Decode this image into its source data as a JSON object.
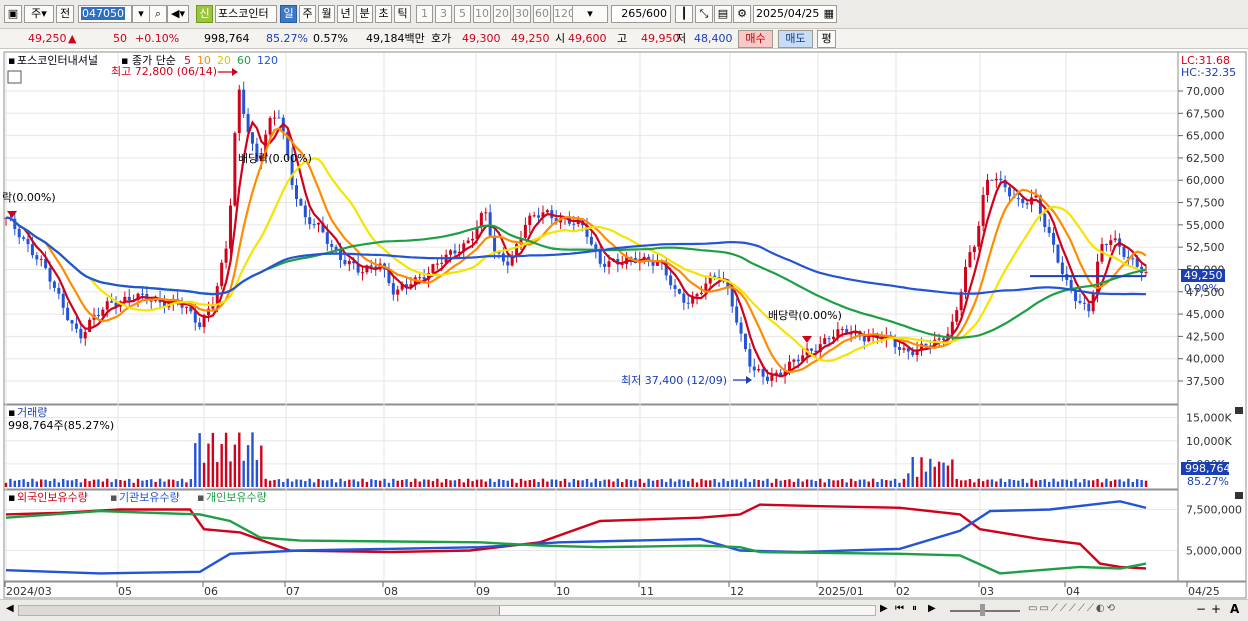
{
  "toolbar": {
    "market_dropdown": "주",
    "prev_label": "전",
    "stock_code": "047050",
    "sin_label": "신",
    "stock_name": "포스코인터",
    "periods": [
      "일",
      "주",
      "월",
      "년",
      "분",
      "초",
      "틱"
    ],
    "active_period": "일",
    "intervals": [
      "1",
      "3",
      "5",
      "10",
      "20",
      "30",
      "60",
      "120"
    ],
    "count_value": "265",
    "count_max": "/600",
    "date_value": "2025/04/25"
  },
  "quote": {
    "price": "49,250",
    "change": "50",
    "change_pct": "+0.10%",
    "volume": "998,764",
    "vol_ratio": "85.27%",
    "turnover": "0.57%",
    "trade_value": "49,184백만",
    "ask_label": "호가",
    "ask1": "49,300",
    "ask2": "49,250",
    "open_label": "시",
    "open": "49,600",
    "high_label": "고",
    "high": "49,950",
    "low_label": "저",
    "low": "48,400",
    "buy_button": "매수",
    "sell_button": "매도",
    "eval_button": "평"
  },
  "price_panel": {
    "title": "포스코인터내셔널",
    "ma_label": "종가 단순",
    "ma_periods": [
      "5",
      "10",
      "20",
      "60",
      "120"
    ],
    "ma_colors": [
      "#d0021b",
      "#ff8c00",
      "#f5e400",
      "#1e9e45",
      "#2454d6"
    ],
    "lc": "LC:31.68",
    "hc": "HC:-32.35",
    "y_ticks": [
      "70,000",
      "67,500",
      "65,000",
      "62,500",
      "60,000",
      "57,500",
      "55,000",
      "52,500",
      "50,000",
      "47,500",
      "45,000",
      "42,500",
      "40,000",
      "37,500"
    ],
    "current_price_tag": "49,250",
    "current_pct_tag": "0.00%",
    "max_annotation": "최고 72,800 (06/14)",
    "min_annotation": "최저 37,400 (12/09)",
    "dividend_labels": [
      "락(0.00%)",
      "배당락(0.00%)",
      "배당락(0.00%)"
    ]
  },
  "volume_panel": {
    "title": "거래량",
    "value_label": "998,764주(85.27%)",
    "y_ticks": [
      "15,000K",
      "10,000K",
      "5,000K"
    ],
    "current_tag": "998,764",
    "pct_tag": "85.27%"
  },
  "holding_panel": {
    "labels": [
      "외국인보유수량",
      "기관보유수량",
      "개인보유수량"
    ],
    "colors": [
      "#d0021b",
      "#2454d6",
      "#1e9e45"
    ],
    "y_ticks": [
      "7,500,000",
      "5,000,000"
    ]
  },
  "x_axis": {
    "labels": [
      "2024/03",
      "05",
      "06",
      "07",
      "08",
      "09",
      "10",
      "11",
      "12",
      "2025/01",
      "02",
      "03",
      "04",
      "04/25"
    ]
  },
  "chart_data": {
    "type": "candlestick",
    "ylim": [
      36500,
      73500
    ],
    "max_price": 72800,
    "min_price": 37400,
    "last_price": 49250,
    "months": [
      "2024/03",
      "05",
      "06",
      "07",
      "08",
      "09",
      "10",
      "11",
      "12",
      "2025/01",
      "02",
      "03",
      "04"
    ]
  }
}
